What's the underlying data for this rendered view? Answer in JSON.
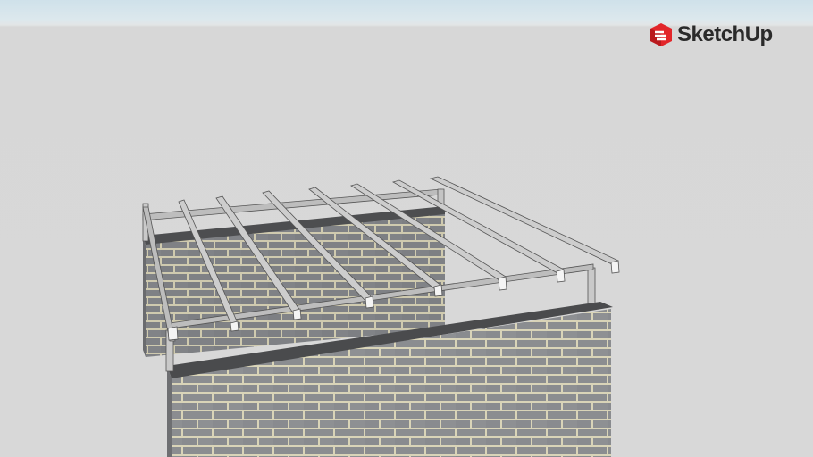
{
  "app": {
    "brand_name": "SketchUp",
    "brand_color": "#e2262a",
    "logo_icon": "sketchup-logo-icon"
  },
  "viewport": {
    "sky_color": "#cfe1ea",
    "ground_color": "#d8d8d8",
    "brick_color": "#8e9093",
    "mortar_color": "#d9d4b8",
    "beam_color": "#cfcfcf"
  }
}
